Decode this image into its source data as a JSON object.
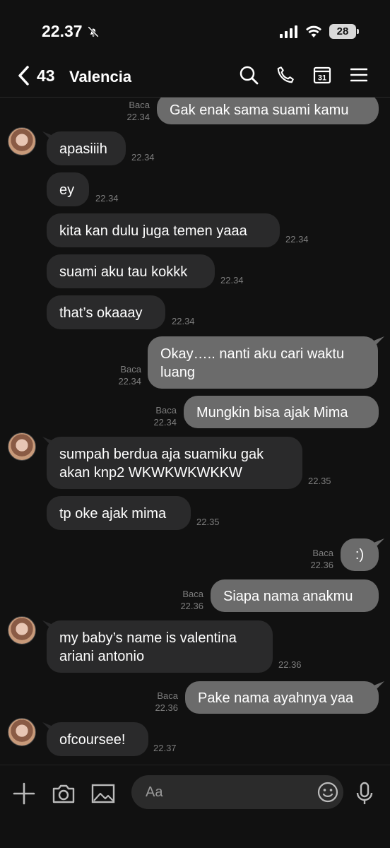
{
  "status_bar": {
    "time": "22.37",
    "battery": "28"
  },
  "header": {
    "unread_count": "43",
    "contact_name": "Valencia"
  },
  "messages": [
    {
      "dir": "out",
      "text": "Gak enak sama suami kamu",
      "read": "Baca",
      "time": "22.34"
    },
    {
      "dir": "in",
      "text": "apasiiih",
      "time": "22.34"
    },
    {
      "dir": "in",
      "text": "ey",
      "time": "22.34"
    },
    {
      "dir": "in",
      "text": "kita kan dulu juga temen yaaa",
      "time": "22.34"
    },
    {
      "dir": "in",
      "text": "suami aku tau kokkk",
      "time": "22.34"
    },
    {
      "dir": "in",
      "text": "that’s okaaay",
      "time": "22.34"
    },
    {
      "dir": "out",
      "text_line1": "Okay….. nanti aku cari waktu",
      "text_line2": "luang",
      "read": "Baca",
      "time": "22.34"
    },
    {
      "dir": "out",
      "text": "Mungkin bisa ajak Mima",
      "read": "Baca",
      "time": "22.34"
    },
    {
      "dir": "in",
      "text_line1": "sumpah berdua aja suamiku gak",
      "text_line2": "akan knp2 WKWKWKWKKW",
      "time": "22.35"
    },
    {
      "dir": "in",
      "text": "tp oke ajak mima",
      "time": "22.35"
    },
    {
      "dir": "out",
      "text": ":)",
      "read": "Baca",
      "time": "22.36"
    },
    {
      "dir": "out",
      "text": "Siapa nama anakmu",
      "read": "Baca",
      "time": "22.36"
    },
    {
      "dir": "in",
      "text_line1": "my baby’s name is valentina",
      "text_line2": "ariani antonio",
      "time": "22.36"
    },
    {
      "dir": "out",
      "text": "Pake nama ayahnya yaa",
      "read": "Baca",
      "time": "22.36"
    },
    {
      "dir": "in",
      "text": "ofcoursee!",
      "time": "22.37"
    }
  ],
  "composer": {
    "placeholder": "Aa"
  },
  "icons": {
    "back": "chevron-left-icon",
    "search": "search-icon",
    "call": "phone-icon",
    "calendar": "calendar-icon",
    "calendar_day": "31",
    "menu": "menu-icon",
    "add": "plus-icon",
    "camera": "camera-icon",
    "gallery": "image-icon",
    "emoji": "emoji-icon",
    "mic": "microphone-icon",
    "mute": "bell-slash-icon"
  },
  "colors": {
    "background": "#111111",
    "incoming_bubble": "#2a2a2b",
    "outgoing_bubble": "#6b6b6b"
  }
}
